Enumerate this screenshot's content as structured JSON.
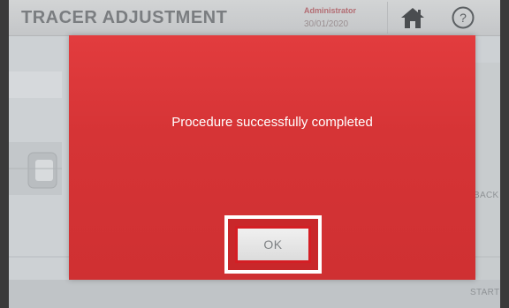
{
  "header": {
    "title": "TRACER ADJUSTMENT",
    "user_role": "Administrator",
    "user_date": "30/01/2020",
    "home_icon": "home-icon",
    "help_label": "?"
  },
  "side": {
    "back_label": "BACK",
    "start_label": "START",
    "next_icon": "arrow-right-icon"
  },
  "dialog": {
    "message": "Procedure successfully completed",
    "ok_label": "OK"
  },
  "colors": {
    "dialog_red": "#d63436",
    "ok_border": "#d41e24",
    "title_grey": "#7a7d80"
  }
}
